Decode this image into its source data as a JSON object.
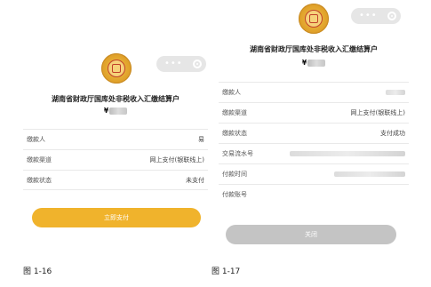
{
  "left": {
    "title": "湖南省财政厅国库处非税收入汇缴结算户",
    "amount_prefix": "¥",
    "rows": [
      {
        "label": "缴款人",
        "value": "易"
      },
      {
        "label": "缴款渠道",
        "value": "网上支付(银联线上)"
      },
      {
        "label": "缴款状态",
        "value": "未支付"
      }
    ],
    "button_label": "立即支付",
    "caption": "图 1-16"
  },
  "right": {
    "title": "湖南省财政厅国库处非税收入汇缴结算户",
    "amount_prefix": "¥",
    "rows": [
      {
        "label": "缴款人",
        "value": ""
      },
      {
        "label": "缴款渠道",
        "value": "网上支付(银联线上)"
      },
      {
        "label": "缴款状态",
        "value": "支付成功"
      },
      {
        "label": "交易流水号",
        "value": ""
      },
      {
        "label": "付款时间",
        "value": ""
      },
      {
        "label": "付款账号",
        "value": ""
      }
    ],
    "button_label": "关闭",
    "caption": "图 1-17"
  },
  "colors": {
    "pay_button": "#f0b32c",
    "close_button": "#c4c4c4",
    "capsule": "#e6e6e6"
  },
  "icons": [
    "seal-emblem-icon",
    "more-dots-icon",
    "close-target-icon"
  ]
}
